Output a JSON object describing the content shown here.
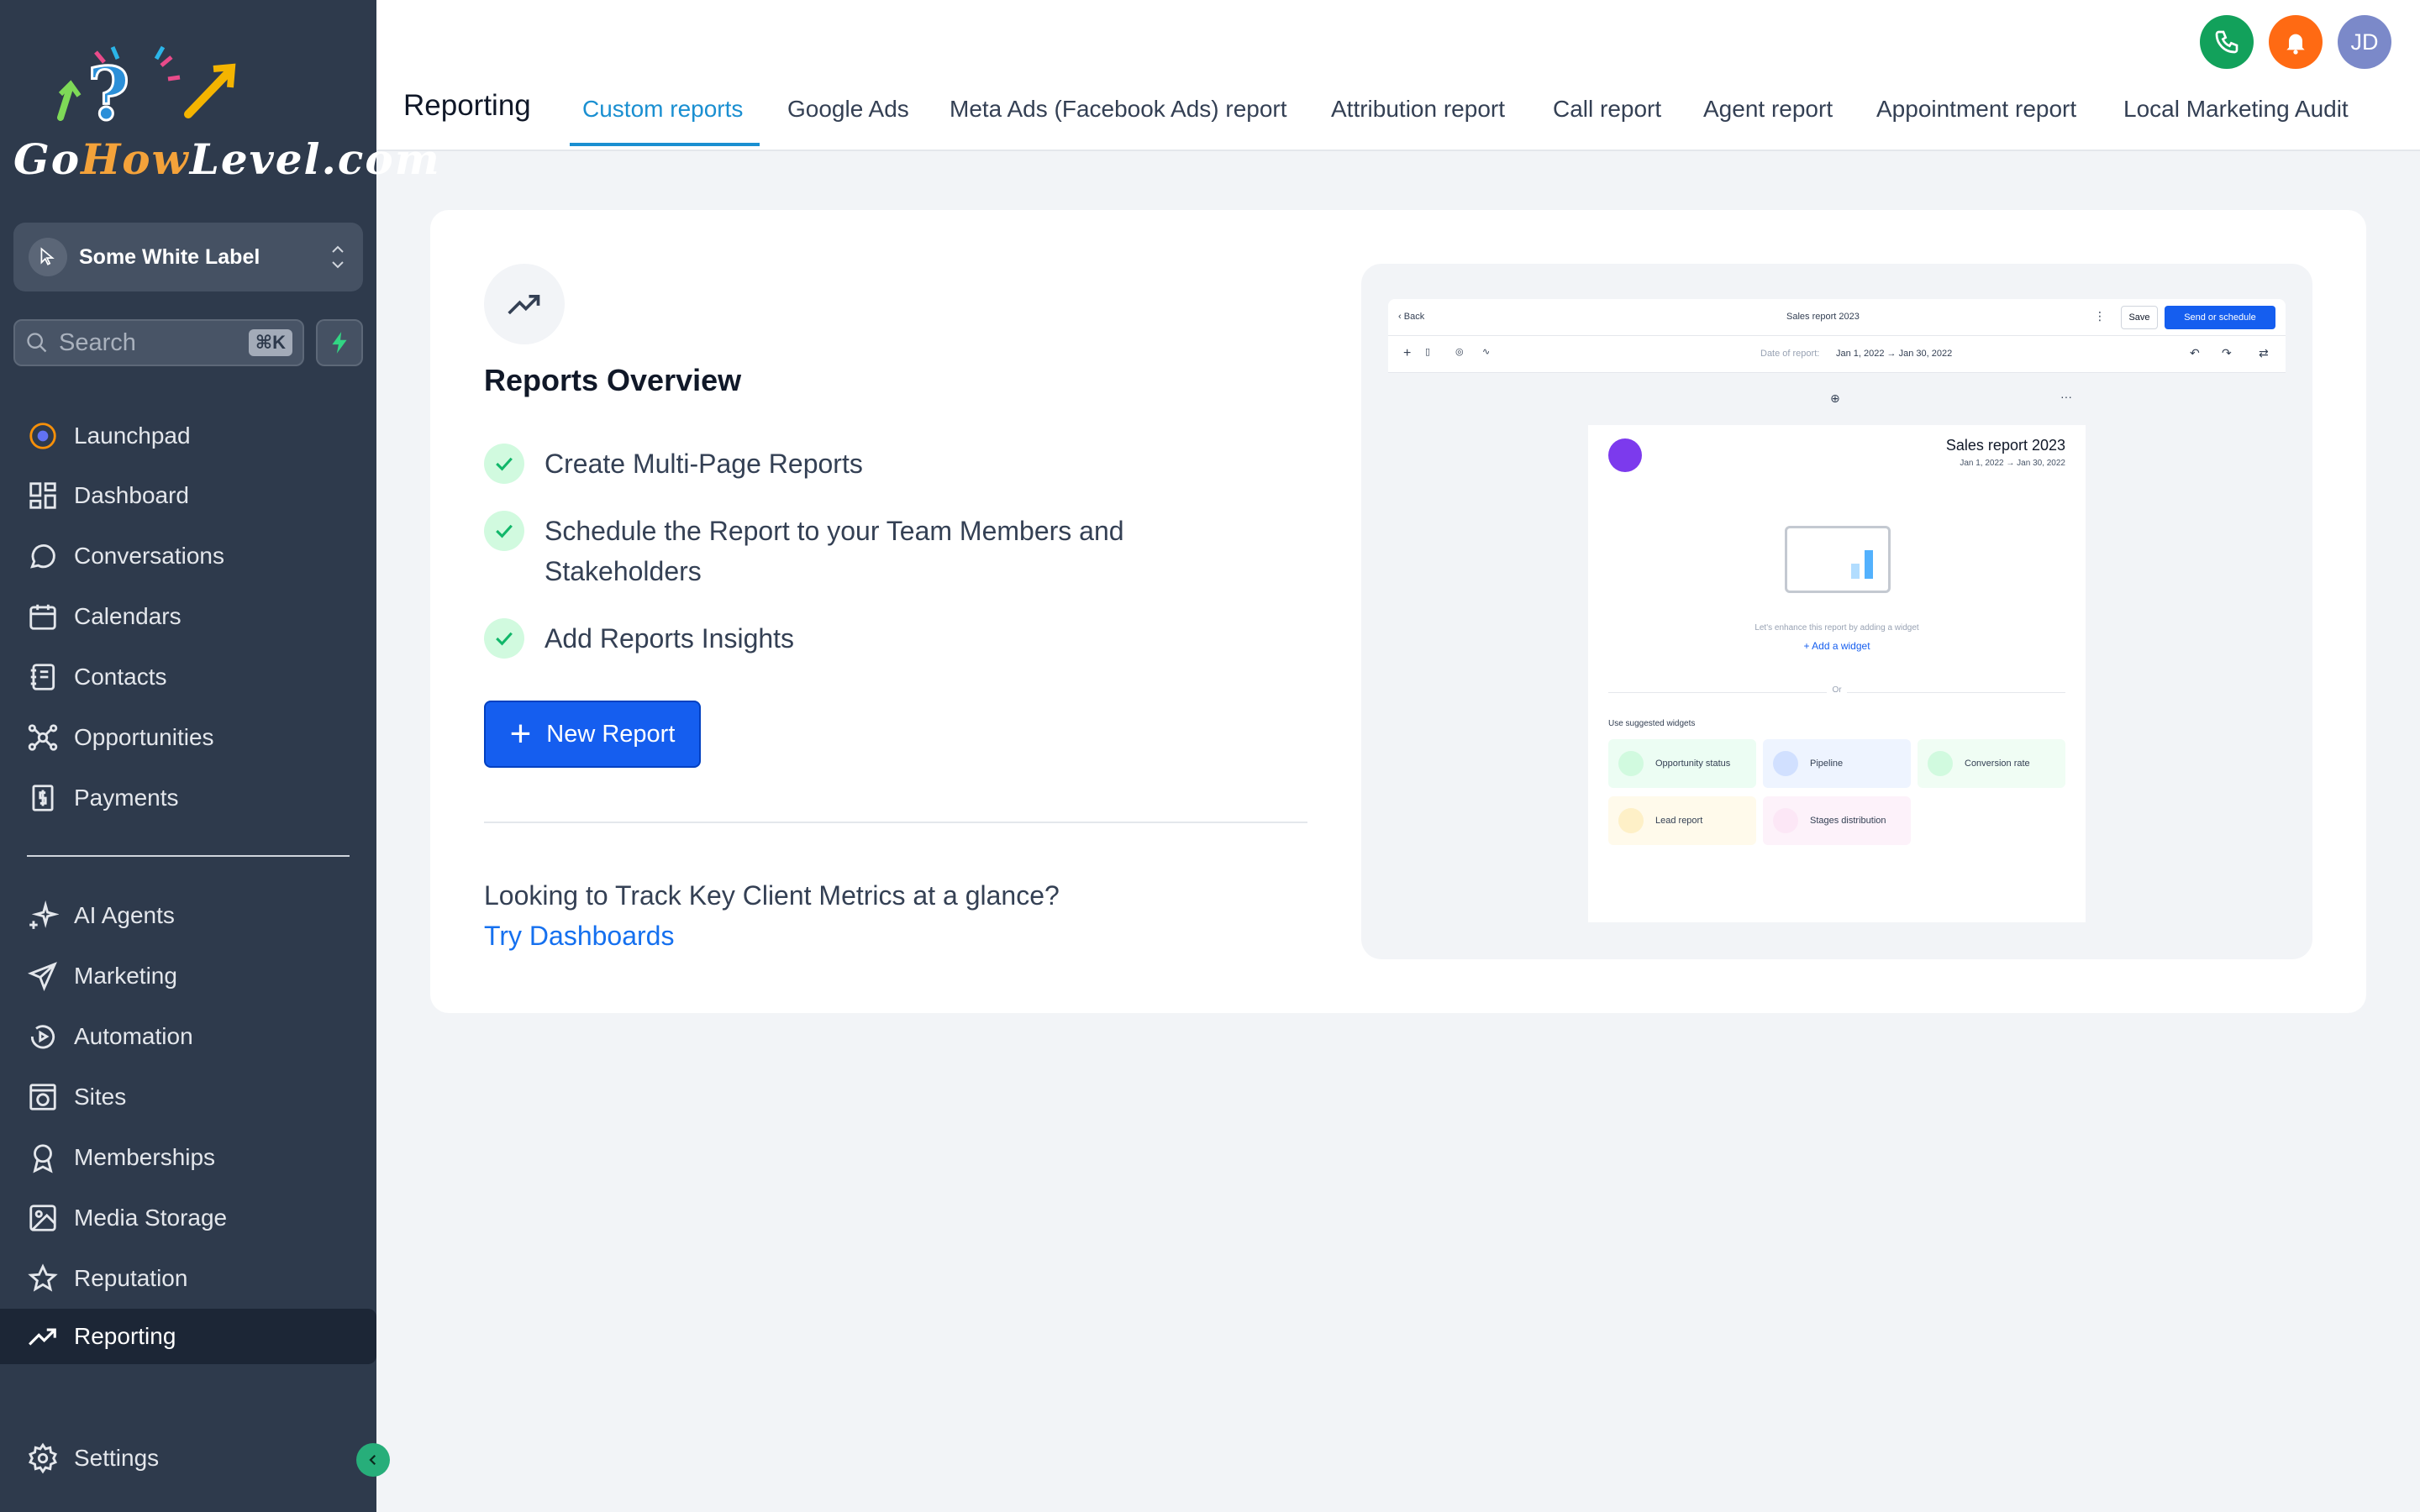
{
  "logo": {
    "text_go": "Go",
    "text_how": "How",
    "text_rest": "Level.com"
  },
  "account": {
    "name": "Some White Label"
  },
  "search": {
    "placeholder": "Search",
    "shortcut": "⌘K"
  },
  "sidebar": {
    "items": [
      {
        "label": "Launchpad",
        "icon": "launchpad-icon"
      },
      {
        "label": "Dashboard",
        "icon": "dashboard-icon"
      },
      {
        "label": "Conversations",
        "icon": "chat-bubble-icon"
      },
      {
        "label": "Calendars",
        "icon": "calendar-icon"
      },
      {
        "label": "Contacts",
        "icon": "contacts-icon"
      },
      {
        "label": "Opportunities",
        "icon": "opportunities-icon"
      },
      {
        "label": "Payments",
        "icon": "payments-icon"
      },
      {
        "label": "AI Agents",
        "icon": "sparkle-icon"
      },
      {
        "label": "Marketing",
        "icon": "send-icon"
      },
      {
        "label": "Automation",
        "icon": "automation-icon"
      },
      {
        "label": "Sites",
        "icon": "globe-icon"
      },
      {
        "label": "Memberships",
        "icon": "badge-icon"
      },
      {
        "label": "Media Storage",
        "icon": "image-icon"
      },
      {
        "label": "Reputation",
        "icon": "star-icon"
      },
      {
        "label": "Reporting",
        "icon": "trend-icon"
      }
    ],
    "settings": "Settings",
    "active": "Reporting"
  },
  "header": {
    "title": "Reporting",
    "tabs": [
      "Custom reports",
      "Google Ads",
      "Meta Ads (Facebook Ads) report",
      "Attribution report",
      "Call report",
      "Agent report",
      "Appointment report",
      "Local Marketing Audit"
    ],
    "active_tab": "Custom reports",
    "avatar_initials": "JD",
    "colors": {
      "phone": "#12a15b",
      "bell": "#ff6a13",
      "avatar": "#7b89c9",
      "accent": "#1a8fd1"
    }
  },
  "overview": {
    "title": "Reports Overview",
    "features": [
      "Create Multi-Page Reports",
      "Schedule the Report to your Team Members and Stakeholders",
      "Add Reports Insights"
    ],
    "new_button": "New Report",
    "track_text": "Looking to Track Key Client Metrics at a glance?",
    "try_link": "Try Dashboards"
  },
  "preview": {
    "back": "Back",
    "report_title": "Sales report 2023",
    "save": "Save",
    "send": "Send or schedule",
    "date_label": "Date of report:",
    "date_range": "Jan 1, 2022 → Jan 30, 2022",
    "page_title": "Sales report 2023",
    "page_date": "Jan 1, 2022 → Jan 30, 2022",
    "enhance": "Let's enhance this report by adding a widget",
    "add_widget": "Add a widget",
    "or": "Or",
    "suggested": "Use suggested widgets",
    "widgets": [
      "Opportunity status",
      "Pipeline",
      "Conversion rate",
      "Lead report",
      "Stages distribution"
    ]
  }
}
